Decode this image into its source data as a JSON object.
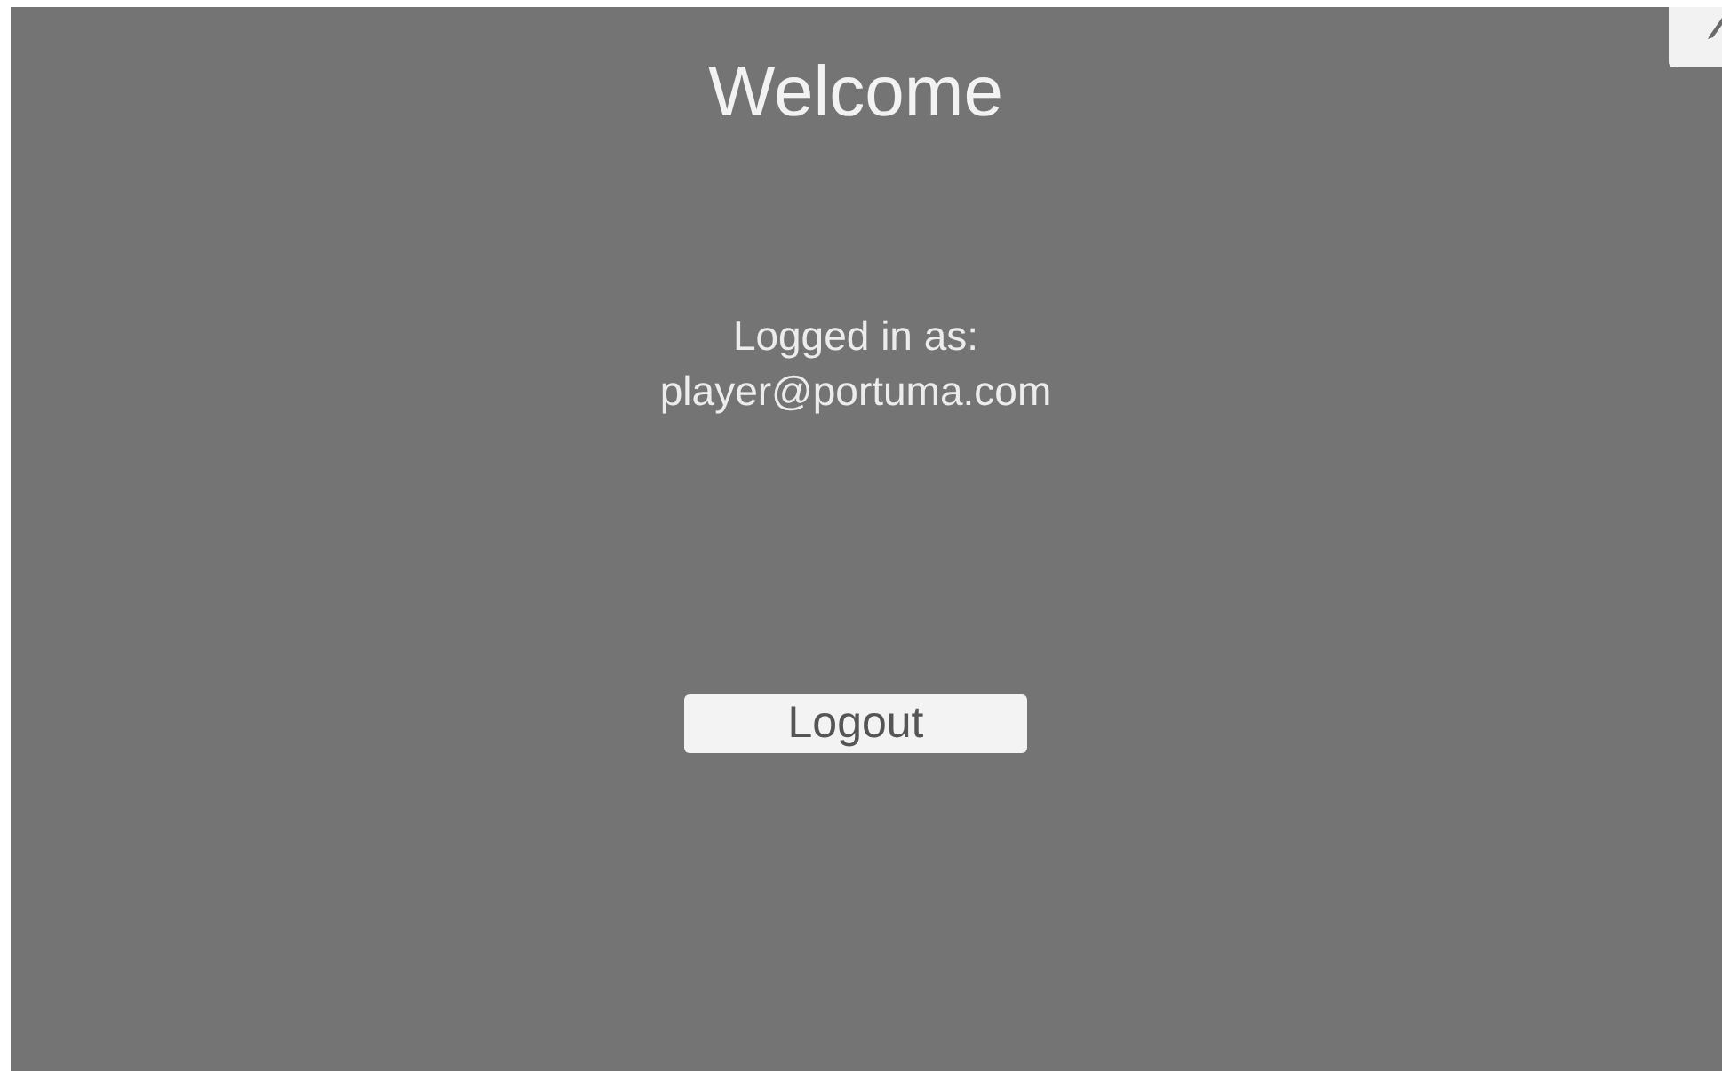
{
  "title": "Welcome",
  "status_lines": [
    "Logged in as:",
    "player@portuma.com"
  ],
  "logout_button": {
    "label": "Logout"
  }
}
